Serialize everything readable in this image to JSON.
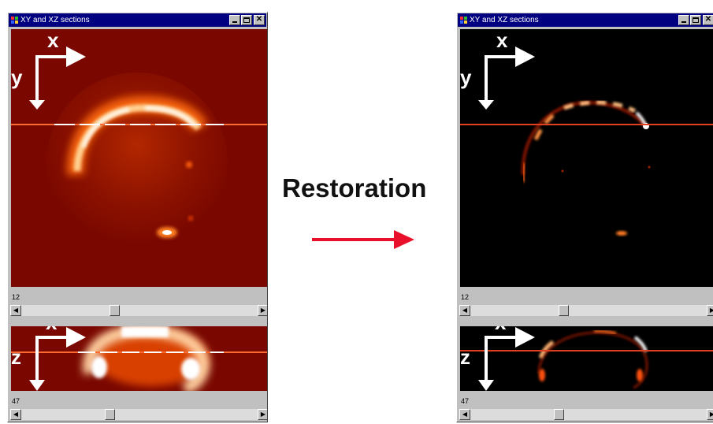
{
  "left_window": {
    "title": "XY and XZ sections",
    "xy_axes": {
      "h": "x",
      "v": "y"
    },
    "xz_axes": {
      "h": "x",
      "v": "z"
    },
    "slider1_value": "12",
    "slider2_value": "47",
    "slider1_position": 0.41,
    "slider2_position": 0.38
  },
  "right_window": {
    "title": "XY and XZ sections",
    "xy_axes": {
      "h": "x",
      "v": "y"
    },
    "xz_axes": {
      "h": "x",
      "v": "z"
    },
    "slider1_value": "12",
    "slider2_value": "47",
    "slider1_position": 0.41,
    "slider2_position": 0.38
  },
  "center": {
    "label": "Restoration"
  },
  "colors": {
    "raw_background": "#7a0800",
    "restored_background": "#000000",
    "arrow": "#e8102a",
    "titlebar": "#000080"
  },
  "icons": [
    "app-icon",
    "minimize-icon",
    "maximize-icon",
    "close-icon",
    "scroll-left-icon",
    "scroll-right-icon",
    "arrow-right-icon"
  ]
}
